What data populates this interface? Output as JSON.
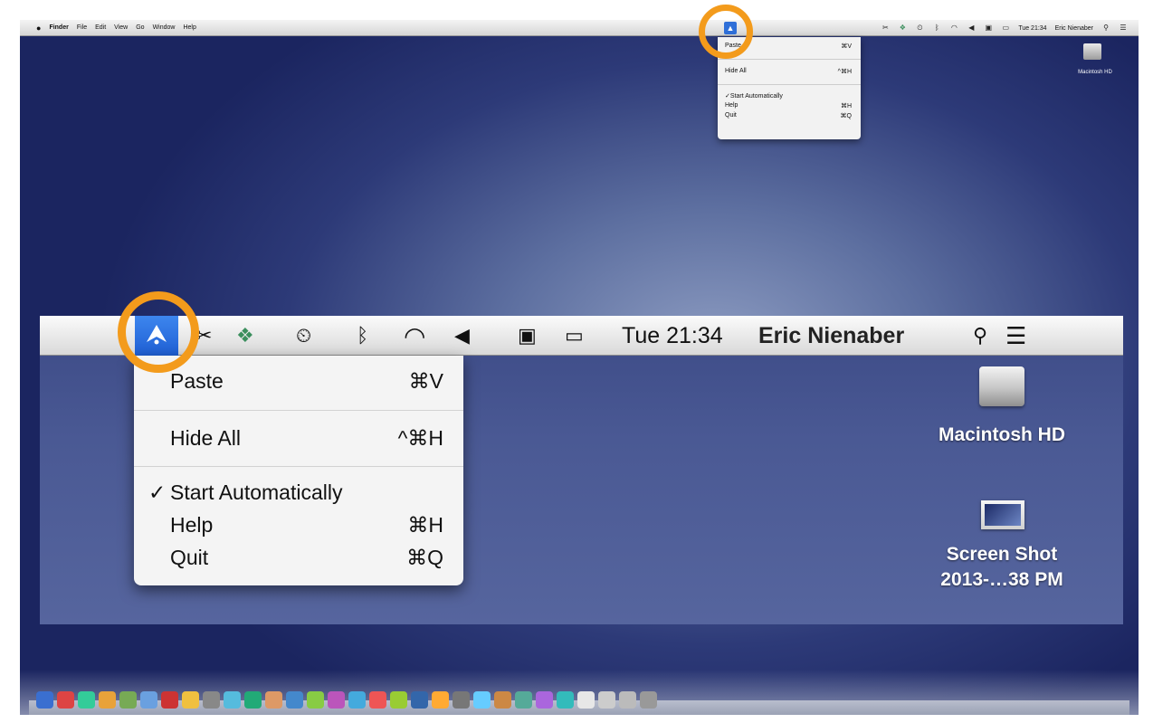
{
  "menubar": {
    "apple_glyph": "",
    "app_name": "Finder",
    "menus": [
      "File",
      "Edit",
      "View",
      "Go",
      "Window",
      "Help"
    ],
    "clock": "Tue 21:34",
    "user": "Eric Nienaber"
  },
  "status_menu": {
    "items": [
      {
        "label": "Paste",
        "shortcut": "⌘V",
        "checked": false
      },
      {
        "label": "Hide All",
        "shortcut": "^⌘H",
        "checked": false
      },
      {
        "label": "Start Automatically",
        "shortcut": "",
        "checked": true
      },
      {
        "label": "Help",
        "shortcut": "⌘H",
        "checked": false
      },
      {
        "label": "Quit",
        "shortcut": "⌘Q",
        "checked": false
      }
    ],
    "check_mark": "✓"
  },
  "desktop": {
    "hd_label": "Macintosh HD",
    "screenshot_label_line1": "Screen Shot",
    "screenshot_label_line2": "2013-…38 PM"
  },
  "icons": {
    "status_icons": [
      "app-arrow-icon",
      "tools-icon",
      "dropbox-icon",
      "time-machine-icon",
      "bluetooth-icon",
      "wifi-icon",
      "volume-icon",
      "display-icon",
      "battery-icon",
      "spotlight-icon",
      "notification-center-icon"
    ],
    "glyphs": {
      "tools": "✂",
      "dropbox": "❖",
      "time_machine": "⏲",
      "bluetooth": "ᛒ",
      "wifi": "◠",
      "volume": "◀",
      "display": "▣",
      "battery": "▭",
      "spotlight": "⚲",
      "notification": "☰"
    }
  },
  "colors": {
    "highlight_ring": "#f39b1c",
    "menu_selection": "#2f6fd8",
    "desktop_dark": "#1b2560"
  }
}
